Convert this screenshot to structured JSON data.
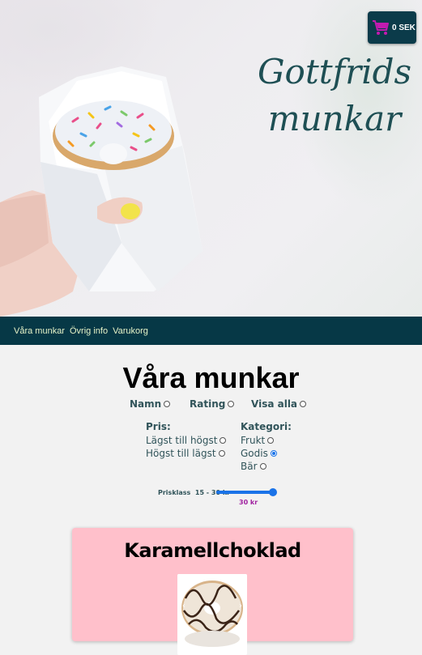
{
  "hero": {
    "logo_line1": "Gottfrids",
    "logo_line2": "munkar"
  },
  "cart": {
    "total": "0 SEK",
    "icon": "shopping-cart-icon",
    "icon_color": "#c21bb0"
  },
  "nav": {
    "items": [
      "Våra munkar",
      "Övrig info",
      "Varukorg"
    ]
  },
  "main": {
    "title": "Våra munkar",
    "sort": [
      "Namn",
      "Rating",
      "Visa alla"
    ],
    "price_filter": {
      "heading": "Pris:",
      "options": [
        "Lägst till högst",
        "Högst till lägst"
      ]
    },
    "category_filter": {
      "heading": "Kategori:",
      "options": [
        "Frukt",
        "Godis",
        "Bär"
      ],
      "selected": "Godis"
    },
    "price_range": {
      "label": "Prisklass",
      "range_text": "15 - 30 kr",
      "value_text": "30 kr",
      "value_fraction": 1.0
    }
  },
  "product": {
    "name": "Karamellchoklad",
    "prev_label": "‹",
    "next_label": "›"
  },
  "colors": {
    "nav_bg": "#063846",
    "nav_text": "#e6f2c7",
    "logo": "#1e4f54",
    "card_bg": "#ffc0cb",
    "accent": "#1a73e8"
  }
}
